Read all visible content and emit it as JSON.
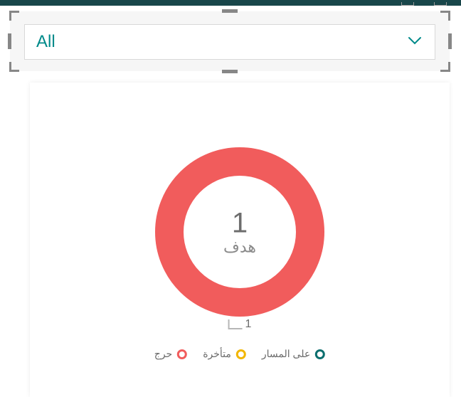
{
  "slicer": {
    "selected_value": "All"
  },
  "chart_data": {
    "type": "pie",
    "title": "",
    "center_value": "1",
    "center_label": "هدف",
    "callout_value": "1",
    "series": [
      {
        "name": "على المسار",
        "value": 0,
        "color": "#0b6e6e"
      },
      {
        "name": "متأخرة",
        "value": 0,
        "color": "#f2b600"
      },
      {
        "name": "حرج",
        "value": 1,
        "color": "#f15c5c"
      }
    ]
  }
}
